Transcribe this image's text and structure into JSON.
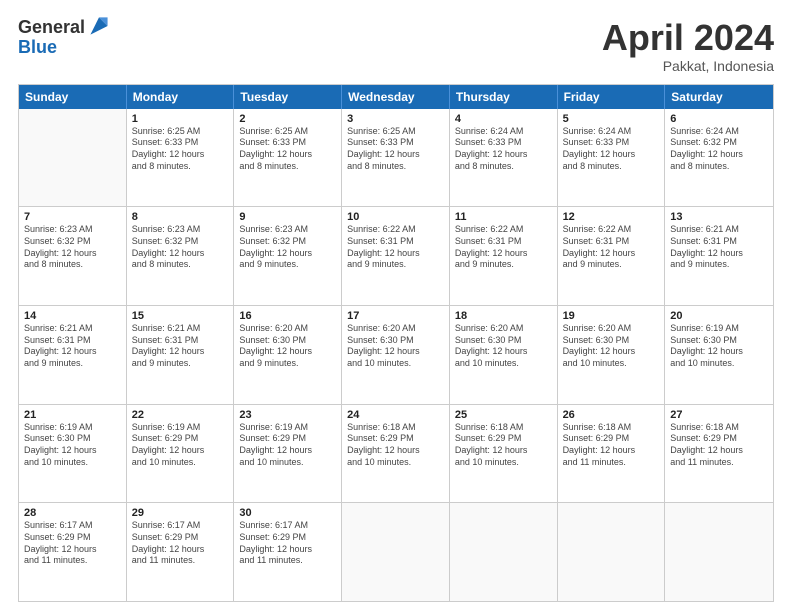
{
  "header": {
    "logo": {
      "general": "General",
      "blue": "Blue"
    },
    "title": "April 2024",
    "subtitle": "Pakkat, Indonesia"
  },
  "calendar": {
    "days": [
      "Sunday",
      "Monday",
      "Tuesday",
      "Wednesday",
      "Thursday",
      "Friday",
      "Saturday"
    ],
    "rows": [
      [
        {
          "day": null,
          "lines": []
        },
        {
          "day": "1",
          "lines": [
            "Sunrise: 6:25 AM",
            "Sunset: 6:33 PM",
            "Daylight: 12 hours",
            "and 8 minutes."
          ]
        },
        {
          "day": "2",
          "lines": [
            "Sunrise: 6:25 AM",
            "Sunset: 6:33 PM",
            "Daylight: 12 hours",
            "and 8 minutes."
          ]
        },
        {
          "day": "3",
          "lines": [
            "Sunrise: 6:25 AM",
            "Sunset: 6:33 PM",
            "Daylight: 12 hours",
            "and 8 minutes."
          ]
        },
        {
          "day": "4",
          "lines": [
            "Sunrise: 6:24 AM",
            "Sunset: 6:33 PM",
            "Daylight: 12 hours",
            "and 8 minutes."
          ]
        },
        {
          "day": "5",
          "lines": [
            "Sunrise: 6:24 AM",
            "Sunset: 6:33 PM",
            "Daylight: 12 hours",
            "and 8 minutes."
          ]
        },
        {
          "day": "6",
          "lines": [
            "Sunrise: 6:24 AM",
            "Sunset: 6:32 PM",
            "Daylight: 12 hours",
            "and 8 minutes."
          ]
        }
      ],
      [
        {
          "day": "7",
          "lines": [
            "Sunrise: 6:23 AM",
            "Sunset: 6:32 PM",
            "Daylight: 12 hours",
            "and 8 minutes."
          ]
        },
        {
          "day": "8",
          "lines": [
            "Sunrise: 6:23 AM",
            "Sunset: 6:32 PM",
            "Daylight: 12 hours",
            "and 8 minutes."
          ]
        },
        {
          "day": "9",
          "lines": [
            "Sunrise: 6:23 AM",
            "Sunset: 6:32 PM",
            "Daylight: 12 hours",
            "and 9 minutes."
          ]
        },
        {
          "day": "10",
          "lines": [
            "Sunrise: 6:22 AM",
            "Sunset: 6:31 PM",
            "Daylight: 12 hours",
            "and 9 minutes."
          ]
        },
        {
          "day": "11",
          "lines": [
            "Sunrise: 6:22 AM",
            "Sunset: 6:31 PM",
            "Daylight: 12 hours",
            "and 9 minutes."
          ]
        },
        {
          "day": "12",
          "lines": [
            "Sunrise: 6:22 AM",
            "Sunset: 6:31 PM",
            "Daylight: 12 hours",
            "and 9 minutes."
          ]
        },
        {
          "day": "13",
          "lines": [
            "Sunrise: 6:21 AM",
            "Sunset: 6:31 PM",
            "Daylight: 12 hours",
            "and 9 minutes."
          ]
        }
      ],
      [
        {
          "day": "14",
          "lines": [
            "Sunrise: 6:21 AM",
            "Sunset: 6:31 PM",
            "Daylight: 12 hours",
            "and 9 minutes."
          ]
        },
        {
          "day": "15",
          "lines": [
            "Sunrise: 6:21 AM",
            "Sunset: 6:31 PM",
            "Daylight: 12 hours",
            "and 9 minutes."
          ]
        },
        {
          "day": "16",
          "lines": [
            "Sunrise: 6:20 AM",
            "Sunset: 6:30 PM",
            "Daylight: 12 hours",
            "and 9 minutes."
          ]
        },
        {
          "day": "17",
          "lines": [
            "Sunrise: 6:20 AM",
            "Sunset: 6:30 PM",
            "Daylight: 12 hours",
            "and 10 minutes."
          ]
        },
        {
          "day": "18",
          "lines": [
            "Sunrise: 6:20 AM",
            "Sunset: 6:30 PM",
            "Daylight: 12 hours",
            "and 10 minutes."
          ]
        },
        {
          "day": "19",
          "lines": [
            "Sunrise: 6:20 AM",
            "Sunset: 6:30 PM",
            "Daylight: 12 hours",
            "and 10 minutes."
          ]
        },
        {
          "day": "20",
          "lines": [
            "Sunrise: 6:19 AM",
            "Sunset: 6:30 PM",
            "Daylight: 12 hours",
            "and 10 minutes."
          ]
        }
      ],
      [
        {
          "day": "21",
          "lines": [
            "Sunrise: 6:19 AM",
            "Sunset: 6:30 PM",
            "Daylight: 12 hours",
            "and 10 minutes."
          ]
        },
        {
          "day": "22",
          "lines": [
            "Sunrise: 6:19 AM",
            "Sunset: 6:29 PM",
            "Daylight: 12 hours",
            "and 10 minutes."
          ]
        },
        {
          "day": "23",
          "lines": [
            "Sunrise: 6:19 AM",
            "Sunset: 6:29 PM",
            "Daylight: 12 hours",
            "and 10 minutes."
          ]
        },
        {
          "day": "24",
          "lines": [
            "Sunrise: 6:18 AM",
            "Sunset: 6:29 PM",
            "Daylight: 12 hours",
            "and 10 minutes."
          ]
        },
        {
          "day": "25",
          "lines": [
            "Sunrise: 6:18 AM",
            "Sunset: 6:29 PM",
            "Daylight: 12 hours",
            "and 10 minutes."
          ]
        },
        {
          "day": "26",
          "lines": [
            "Sunrise: 6:18 AM",
            "Sunset: 6:29 PM",
            "Daylight: 12 hours",
            "and 11 minutes."
          ]
        },
        {
          "day": "27",
          "lines": [
            "Sunrise: 6:18 AM",
            "Sunset: 6:29 PM",
            "Daylight: 12 hours",
            "and 11 minutes."
          ]
        }
      ],
      [
        {
          "day": "28",
          "lines": [
            "Sunrise: 6:17 AM",
            "Sunset: 6:29 PM",
            "Daylight: 12 hours",
            "and 11 minutes."
          ]
        },
        {
          "day": "29",
          "lines": [
            "Sunrise: 6:17 AM",
            "Sunset: 6:29 PM",
            "Daylight: 12 hours",
            "and 11 minutes."
          ]
        },
        {
          "day": "30",
          "lines": [
            "Sunrise: 6:17 AM",
            "Sunset: 6:29 PM",
            "Daylight: 12 hours",
            "and 11 minutes."
          ]
        },
        {
          "day": null,
          "lines": []
        },
        {
          "day": null,
          "lines": []
        },
        {
          "day": null,
          "lines": []
        },
        {
          "day": null,
          "lines": []
        }
      ]
    ]
  }
}
